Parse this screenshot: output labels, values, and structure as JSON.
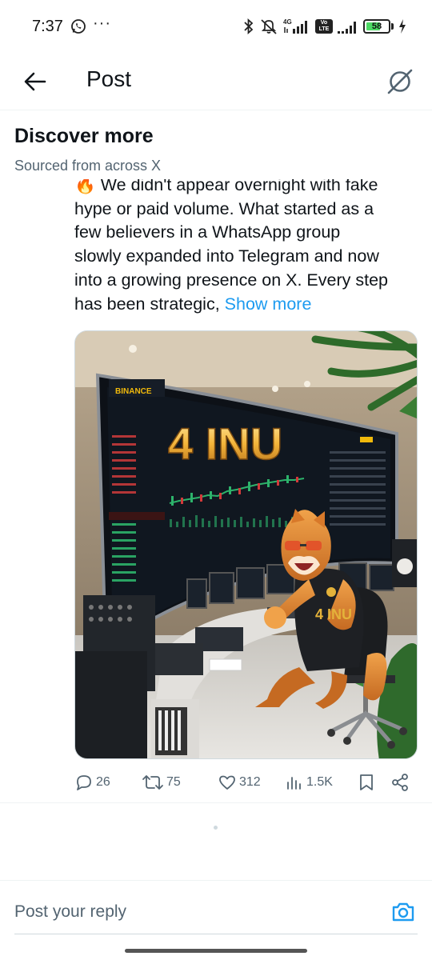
{
  "status_bar": {
    "time": "7:37",
    "dots": "···",
    "network": "4G",
    "volte": "Vo LTE",
    "battery": "58"
  },
  "header": {
    "title": "Post"
  },
  "discover": {
    "title": "Discover more",
    "subtitle": "Sourced from across X"
  },
  "post": {
    "text_lines": [
      "🔥 We didn't appear overnight with fake",
      "hype or paid volume. What started as a",
      "few believers in a WhatsApp group",
      "slowly expanded into Telegram and now",
      "into a growing presence on X. Every step",
      "has been strategic, "
    ],
    "show_more": "Show more",
    "image": {
      "headline": "4 INU",
      "exchange_label": "BINANCE",
      "shirt_text": "4 INU"
    }
  },
  "actions": {
    "replies": "26",
    "reposts": "75",
    "likes": "312",
    "views": "1.5K"
  },
  "reply": {
    "placeholder": "Post your reply"
  },
  "colors": {
    "accent": "#1d9bf0",
    "text_primary": "#0f1419",
    "text_secondary": "#536471",
    "battery_green": "#4cd964"
  },
  "icons": [
    "whatsapp-icon",
    "bluetooth-icon",
    "mute-icon",
    "signal-icon",
    "battery-icon",
    "back-arrow-icon",
    "grok-icon",
    "reply-icon",
    "repost-icon",
    "like-icon",
    "views-icon",
    "bookmark-icon",
    "share-icon",
    "camera-icon"
  ]
}
